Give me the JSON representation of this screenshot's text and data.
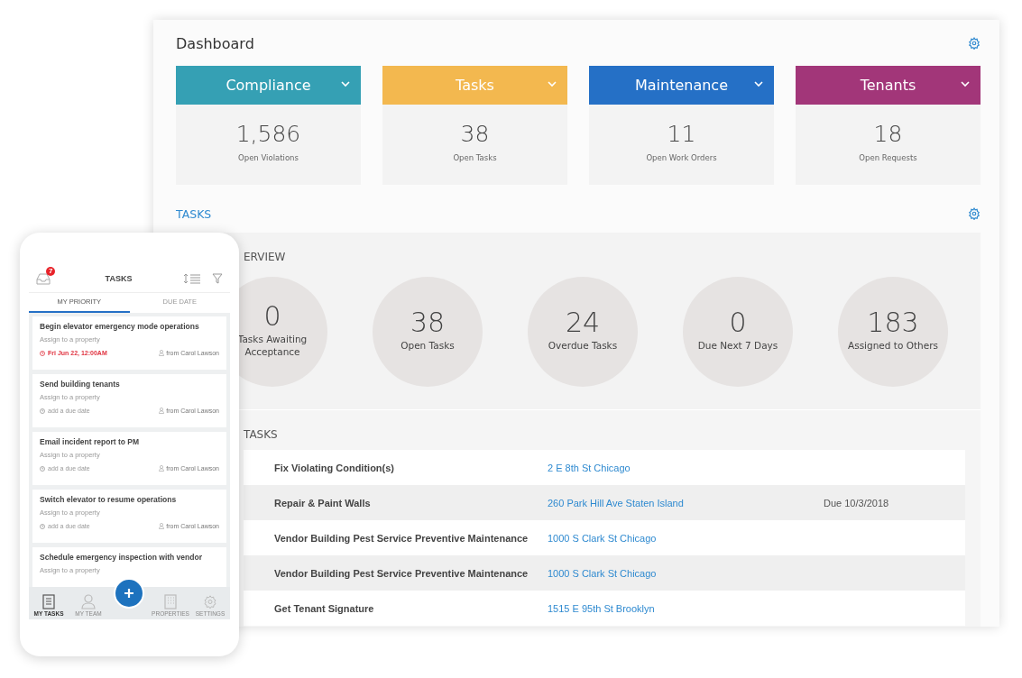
{
  "dashboard": {
    "title": "Dashboard",
    "summary_cards": [
      {
        "title": "Compliance",
        "color": "#35a0b4",
        "value": "1,586",
        "label": "Open Violations"
      },
      {
        "title": "Tasks",
        "color": "#f3b84f",
        "value": "38",
        "label": "Open Tasks"
      },
      {
        "title": "Maintenance",
        "color": "#2570c6",
        "value": "11",
        "label": "Open Work Orders"
      },
      {
        "title": "Tenants",
        "color": "#a23679",
        "value": "18",
        "label": "Open Requests"
      }
    ],
    "section_heading": "TASKS",
    "overview": {
      "heading": "ERVIEW",
      "stats": [
        {
          "value": "0",
          "label": "Tasks Awaiting Acceptance"
        },
        {
          "value": "38",
          "label": "Open Tasks"
        },
        {
          "value": "24",
          "label": "Overdue Tasks"
        },
        {
          "value": "0",
          "label": "Due Next 7 Days"
        },
        {
          "value": "183",
          "label": "Assigned to Others"
        }
      ]
    },
    "task_list": {
      "heading": "TASKS",
      "rows": [
        {
          "task": "Fix Violating Condition(s)",
          "address": "2 E 8th St Chicago"
        },
        {
          "task": "Repair & Paint Walls",
          "address": "260 Park Hill Ave Staten Island",
          "due": "Due 10/3/2018"
        },
        {
          "task": "Vendor Building Pest Service Preventive Maintenance",
          "address": "1000 S Clark St Chicago"
        },
        {
          "task": "Vendor Building Pest Service Preventive Maintenance",
          "address": "1000 S Clark St Chicago"
        },
        {
          "task": "Get Tenant Signature",
          "address": "1515 E 95th St Brooklyn"
        }
      ]
    }
  },
  "phone": {
    "notification_count": "7",
    "title": "TASKS",
    "tabs": [
      {
        "label": "MY PRIORITY",
        "selected": true
      },
      {
        "label": "DUE DATE",
        "selected": false
      }
    ],
    "tasks": [
      {
        "title": "Begin elevator emergency mode operations",
        "property": "Assign to a property",
        "due": "Fri Jun 22, 12:00AM",
        "overdue": true,
        "from": "from Carol Lawson"
      },
      {
        "title": "Send building tenants",
        "property": "Assign to a property",
        "due": "add a due date",
        "overdue": false,
        "from": "from Carol Lawson"
      },
      {
        "title": "Email incident report to PM",
        "property": "Assign to a property",
        "due": "add a due date",
        "overdue": false,
        "from": "from Carol Lawson"
      },
      {
        "title": "Switch elevator to resume operations",
        "property": "Assign to a property",
        "due": "add a due date",
        "overdue": false,
        "from": "from Carol Lawson"
      },
      {
        "title": "Schedule emergency inspection with vendor",
        "property": "Assign to a property"
      }
    ],
    "nav_items": [
      {
        "label": "MY TASKS",
        "kind": "tasks",
        "selected": true
      },
      {
        "label": "MY TEAM",
        "kind": "team",
        "selected": false
      },
      {
        "label": "PROPERTIES",
        "kind": "properties",
        "selected": false
      },
      {
        "label": "SETTINGS",
        "kind": "settings",
        "selected": false
      }
    ]
  }
}
